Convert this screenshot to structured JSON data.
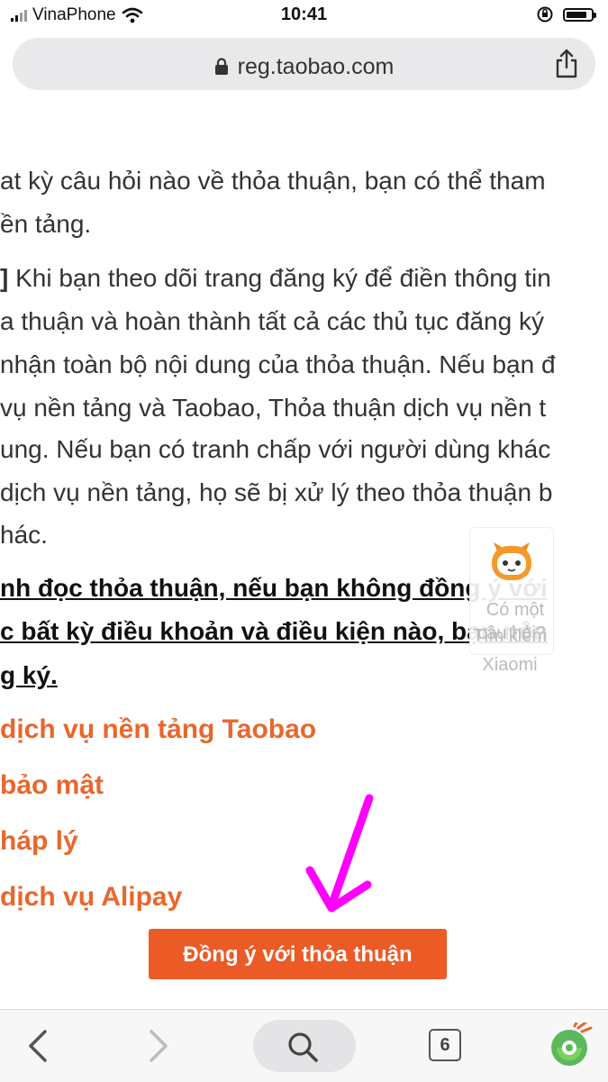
{
  "status_bar": {
    "carrier": "VinaPhone",
    "time": "10:41"
  },
  "browser": {
    "url": "reg.taobao.com",
    "tab_count": "6"
  },
  "page": {
    "lines": [
      "at kỳ câu hỏi nào về thỏa thuận, bạn có thể tham",
      "ền tảng.",
      "a thuận và hoàn thành tất cả các thủ tục đăng ký",
      "nhận toàn bộ nội dung của thỏa thuận. Nếu bạn đ",
      "vụ nền tảng và Taobao, Thỏa thuận dịch vụ nền t",
      "ung. Nếu bạn có tranh chấp với người dùng khác",
      "dịch vụ nền tảng, họ sẽ bị xử lý theo thỏa thuận b",
      "hác."
    ],
    "bracket_prefix": "]",
    "bracket_line": " Khi bạn theo dõi trang đăng ký để điền thông tin",
    "bold_lines": [
      "nh đọc thỏa thuận, nếu bạn không đồng ý với",
      "c bất kỳ điều khoản và điều kiện nào, bạn nên",
      "g ký."
    ],
    "links": [
      "dịch vụ nền tảng Taobao",
      "bảo mật",
      "háp lý",
      "dịch vụ Alipay"
    ]
  },
  "helper": {
    "line1": "Có một",
    "line2": "câu hỏi?",
    "overlay": "Tìm kiếm Xiaomi"
  },
  "agree_button": "Đồng ý với thỏa thuận",
  "colors": {
    "accent": "#ec5a26",
    "link": "#e8672c",
    "arrow": "#ff00ff"
  },
  "icons": [
    "lock-icon",
    "share-icon",
    "back-icon",
    "forward-icon",
    "search-icon",
    "tabs-icon",
    "coccoc-logo-icon",
    "wifi-icon",
    "signal-icon",
    "battery-icon",
    "orientation-lock-icon",
    "helper-mascot-icon",
    "arrow-annotation-icon"
  ]
}
